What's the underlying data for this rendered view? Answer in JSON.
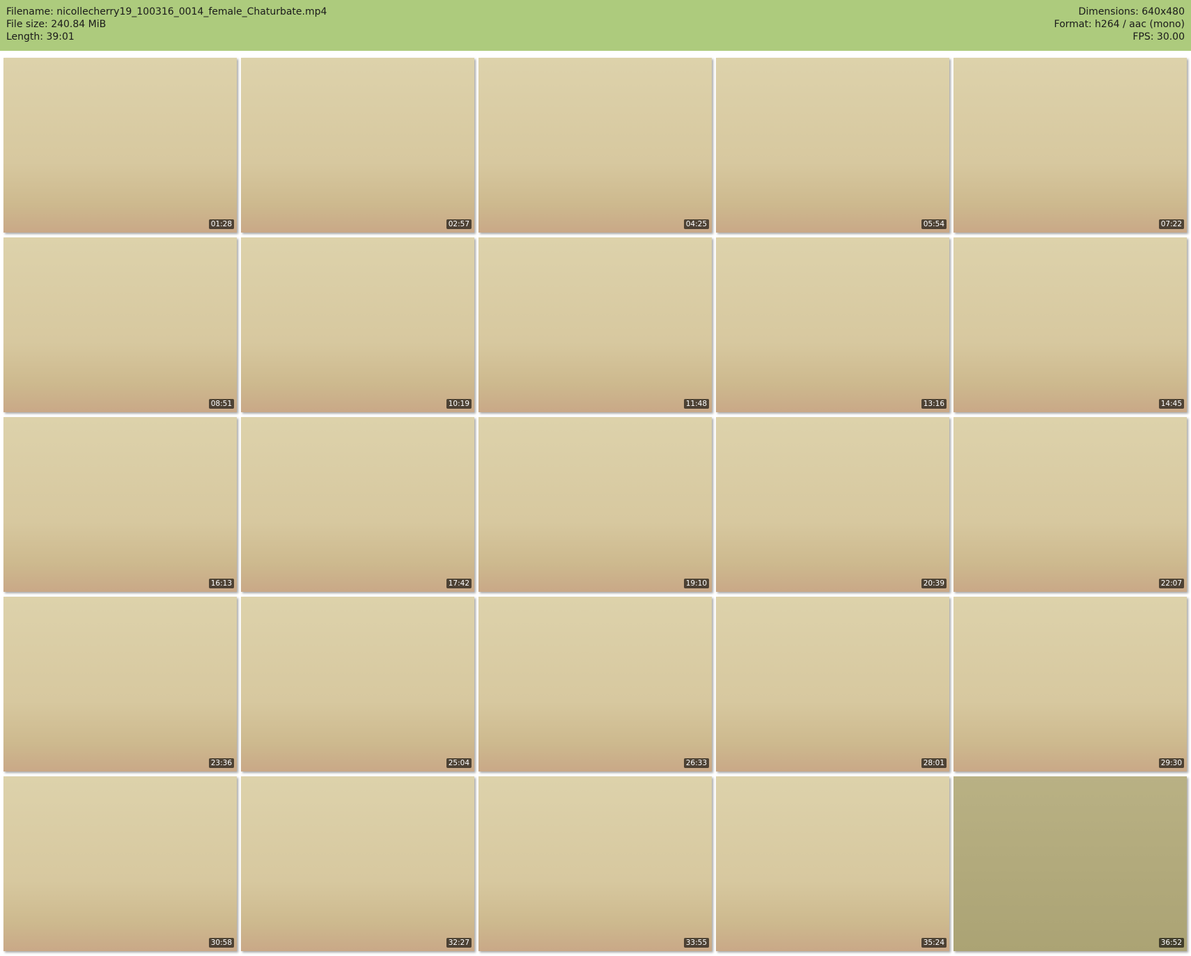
{
  "file_info": {
    "filename": "Filename: nicollecherry19_100316_0014_female_Chaturbate.mp4",
    "file_size": "File size: 240.84 MiB",
    "length": "Length: 39:01",
    "dimensions": "Dimensions: 640x480",
    "format": "Format: h264 / aac (mono)",
    "fps": "FPS: 30.00"
  },
  "colors": {
    "header_bg": "#adcb7d",
    "page_bg": "#ffffff"
  },
  "thumbnails": [
    {
      "time": "01:28"
    },
    {
      "time": "02:57"
    },
    {
      "time": "04:25"
    },
    {
      "time": "05:54"
    },
    {
      "time": "07:22"
    },
    {
      "time": "08:51"
    },
    {
      "time": "10:19"
    },
    {
      "time": "11:48"
    },
    {
      "time": "13:16"
    },
    {
      "time": "14:45"
    },
    {
      "time": "16:13"
    },
    {
      "time": "17:42"
    },
    {
      "time": "19:10"
    },
    {
      "time": "20:39"
    },
    {
      "time": "22:07"
    },
    {
      "time": "23:36"
    },
    {
      "time": "25:04"
    },
    {
      "time": "26:33"
    },
    {
      "time": "28:01"
    },
    {
      "time": "29:30"
    },
    {
      "time": "30:58"
    },
    {
      "time": "32:27"
    },
    {
      "time": "33:55"
    },
    {
      "time": "35:24"
    },
    {
      "time": "36:52"
    }
  ]
}
